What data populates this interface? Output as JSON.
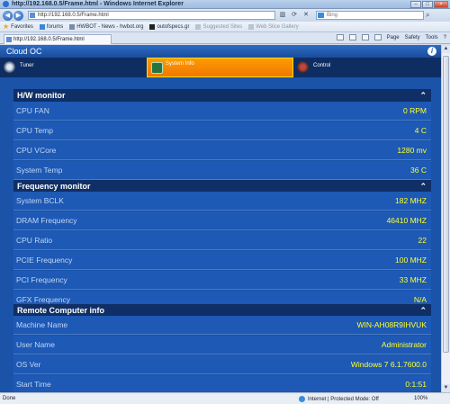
{
  "window": {
    "title": "http://192.168.0.5/Frame.html - Windows Internet Explorer"
  },
  "address": {
    "url": "http://192.168.0.5/Frame.html"
  },
  "search": {
    "placeholder": "Bing"
  },
  "favorites": {
    "label": "Favorites",
    "items": [
      {
        "label": "forums",
        "icon": "ie-icon"
      },
      {
        "label": "HWBOT - News - hwbot.org",
        "icon": "link-icon"
      },
      {
        "label": "outofspecs.gr",
        "icon": "site-icon"
      },
      {
        "label": "Suggested Sites",
        "icon": "suggest-icon"
      },
      {
        "label": "Web Slice Gallery",
        "icon": "webslice-icon"
      }
    ]
  },
  "tab": {
    "label": "http://192.168.0.5/Frame.html"
  },
  "commandbar": {
    "page": "Page",
    "safety": "Safety",
    "tools": "Tools"
  },
  "app": {
    "title": "Cloud OC",
    "info": "i",
    "tabs": [
      {
        "label": "Tuner",
        "icon": "gauge-icon",
        "active": false
      },
      {
        "label": "System Info",
        "icon": "monitor-icon",
        "active": true
      },
      {
        "label": "Control",
        "icon": "wrench-icon",
        "active": false
      }
    ],
    "sections": [
      {
        "title": "H/W monitor",
        "rows": [
          {
            "label": "CPU FAN",
            "value": "0 RPM"
          },
          {
            "label": "CPU Temp",
            "value": "4 C"
          },
          {
            "label": "CPU VCore",
            "value": "1280 mv"
          },
          {
            "label": "System Temp",
            "value": "36 C"
          }
        ]
      },
      {
        "title": "Frequency monitor",
        "rows": [
          {
            "label": "System BCLK",
            "value": "182 MHZ"
          },
          {
            "label": "DRAM Frequency",
            "value": "46410 MHZ"
          },
          {
            "label": "CPU Ratio",
            "value": "22"
          },
          {
            "label": "PCIE Frequency",
            "value": "100 MHZ"
          },
          {
            "label": "PCI Frequency",
            "value": "33 MHZ"
          },
          {
            "label": "GFX Frequency",
            "value": "N/A"
          }
        ]
      },
      {
        "title": "Remote Computer info",
        "rows": [
          {
            "label": "Machine Name",
            "value": "WIN-AH08R9IHVUK"
          },
          {
            "label": "User Name",
            "value": "Administrator"
          },
          {
            "label": "OS Ver",
            "value": "Windows 7 6.1.7600.0"
          },
          {
            "label": "Start Time",
            "value": "0:1:51"
          }
        ]
      }
    ]
  },
  "status": {
    "text": "Done",
    "zone": "Internet | Protected Mode: Off",
    "zoom": "100%"
  },
  "colors": {
    "accent": "#f07800",
    "value_text": "#ffff2a",
    "background": "#1a53a8"
  }
}
